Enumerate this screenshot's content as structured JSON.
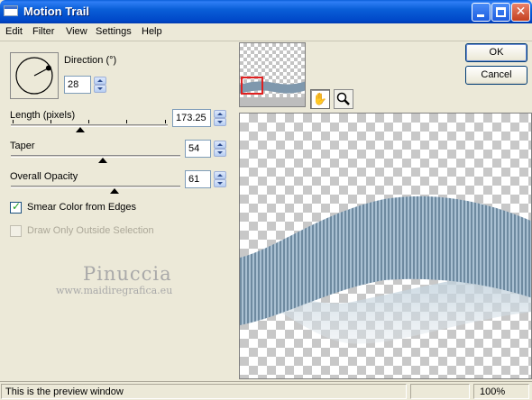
{
  "window": {
    "title": "Motion Trail",
    "close_glyph": "✕"
  },
  "menu": [
    "Edit",
    "Filter",
    "View",
    "Settings",
    "Help"
  ],
  "direction": {
    "label": "Direction (°)",
    "value": "28"
  },
  "length": {
    "label": "Length (pixels)",
    "value": "173.25",
    "fraction": 0.44
  },
  "taper": {
    "label": "Taper",
    "value": "54",
    "fraction": 0.54
  },
  "overall_opacity": {
    "label": "Overall Opacity",
    "value": "61",
    "fraction": 0.61
  },
  "checkboxes": {
    "smear": {
      "label": "Smear Color from Edges",
      "checked": true
    },
    "outside": {
      "label": "Draw Only Outside Selection",
      "checked": false,
      "disabled": true
    }
  },
  "watermark": {
    "name": "Pinuccia",
    "url": "www.maidiregrafica.eu"
  },
  "buttons": {
    "ok": "OK",
    "cancel": "Cancel"
  },
  "tools": {
    "pan": "hand-icon",
    "zoom": "magnifier-icon"
  },
  "status": {
    "message": "This is the preview window",
    "zoom": "100%"
  },
  "colors": {
    "stripe_dark": "#6e8aa0",
    "stripe_light": "#a9c0d2",
    "shadow": "#c9d6df"
  }
}
